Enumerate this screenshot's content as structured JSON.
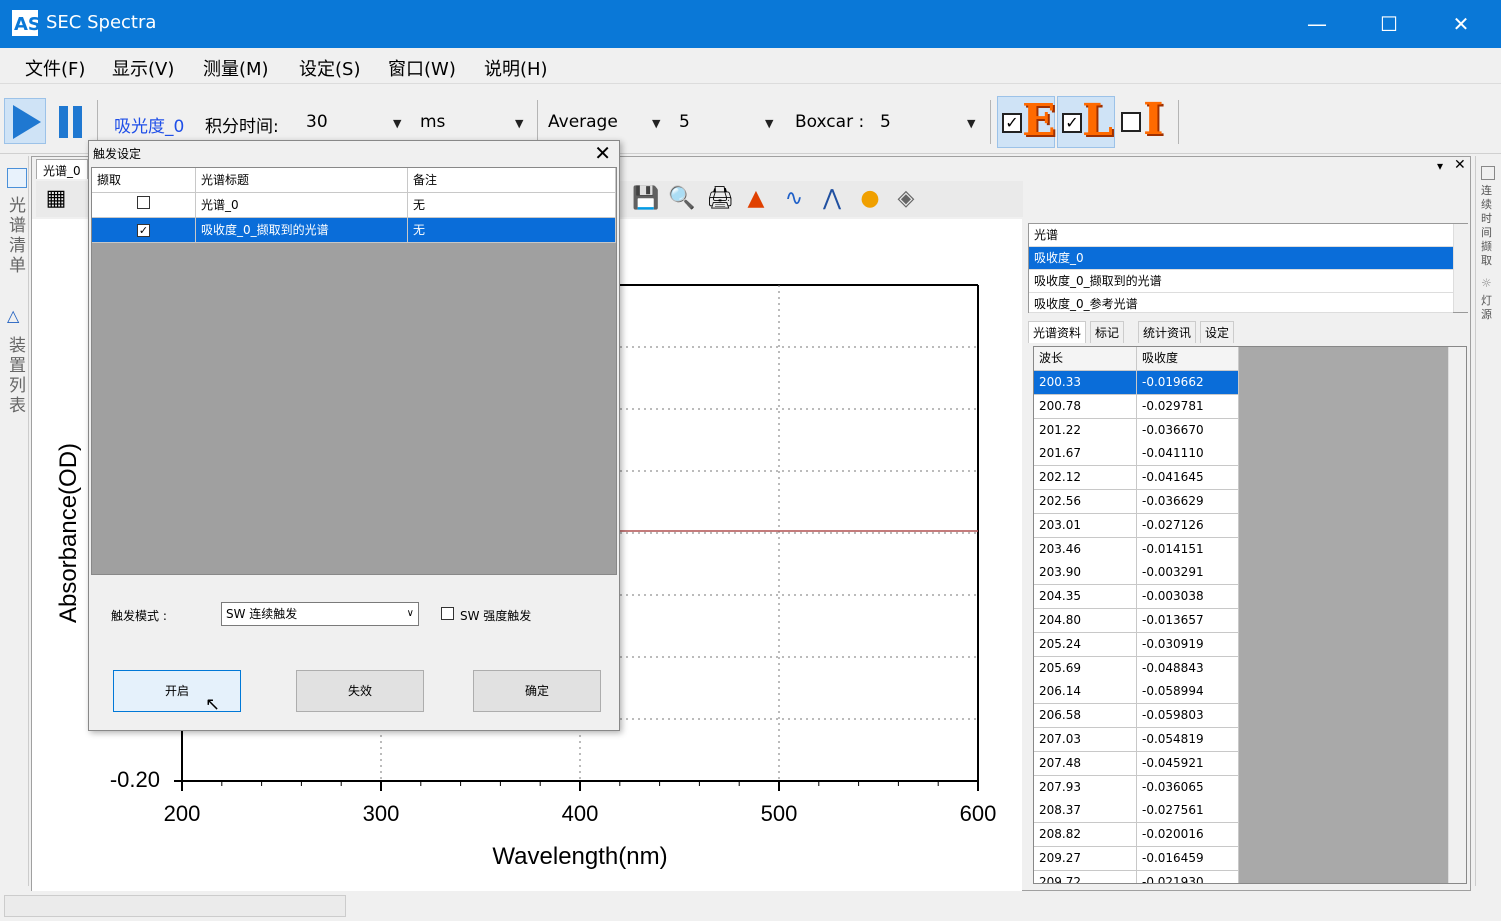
{
  "window": {
    "title": "SEC Spectra",
    "icon_label": "AS"
  },
  "menu": [
    "文件(F)",
    "显示(V)",
    "测量(M)",
    "设定(S)",
    "窗口(W)",
    "说明(H)"
  ],
  "toolbar": {
    "mode_label": "吸光度_0",
    "integration_label": "积分时间:",
    "integration_value": "30",
    "integration_unit": "ms",
    "average_label": "Average",
    "average_value": "5",
    "boxcar_label": "Boxcar :",
    "boxcar_value": "5",
    "eli": [
      {
        "letter": "E",
        "checked": true
      },
      {
        "letter": "L",
        "checked": true
      },
      {
        "letter": "I",
        "checked": false
      }
    ]
  },
  "left_panel": {
    "spectra_list_label": "光谱清单",
    "device_list_label": "装置列表"
  },
  "right_panel": {
    "label_top": "连续时间撷取",
    "label_bottom": "灯源"
  },
  "doc": {
    "tab_label": "光谱_0"
  },
  "chart_data": {
    "type": "line",
    "xlabel": "Wavelength(nm)",
    "ylabel": "Absorbance(OD)",
    "xlim": [
      200,
      600
    ],
    "x_ticks": [
      "200",
      "300",
      "400",
      "500",
      "600"
    ],
    "y_tick_visible": "-0.20",
    "series": [
      {
        "x": [
          420,
          450,
          480,
          500,
          520,
          550,
          580,
          600
        ],
        "values": [
          0.0,
          0.0,
          0.0,
          0.0,
          0.0,
          0.0,
          0.0,
          0.0
        ]
      }
    ],
    "grid": true
  },
  "spectra_panel": {
    "header": "光谱",
    "items": [
      "吸收度_0",
      "吸收度_0_撷取到的光谱",
      "吸收度_0_参考光谱"
    ],
    "selected_index": 0
  },
  "tabs": [
    "光谱资料",
    "标记",
    "统计资讯",
    "设定"
  ],
  "data_table": {
    "columns": [
      "波长",
      "吸收度"
    ],
    "rows": [
      [
        "200.33",
        "-0.019662"
      ],
      [
        "200.78",
        "-0.029781"
      ],
      [
        "201.22",
        "-0.036670"
      ],
      [
        "201.67",
        "-0.041110"
      ],
      [
        "202.12",
        "-0.041645"
      ],
      [
        "202.56",
        "-0.036629"
      ],
      [
        "203.01",
        "-0.027126"
      ],
      [
        "203.46",
        "-0.014151"
      ],
      [
        "203.90",
        "-0.003291"
      ],
      [
        "204.35",
        "-0.003038"
      ],
      [
        "204.80",
        "-0.013657"
      ],
      [
        "205.24",
        "-0.030919"
      ],
      [
        "205.69",
        "-0.048843"
      ],
      [
        "206.14",
        "-0.058994"
      ],
      [
        "206.58",
        "-0.059803"
      ],
      [
        "207.03",
        "-0.054819"
      ],
      [
        "207.48",
        "-0.045921"
      ],
      [
        "207.93",
        "-0.036065"
      ],
      [
        "208.37",
        "-0.027561"
      ],
      [
        "208.82",
        "-0.020016"
      ],
      [
        "209.27",
        "-0.016459"
      ],
      [
        "209.72",
        "-0.021930"
      ]
    ],
    "selected_index": 0
  },
  "dialog": {
    "title": "触发设定",
    "close": "✕",
    "columns": [
      "撷取",
      "光谱标题",
      "备注"
    ],
    "rows": [
      {
        "checked": false,
        "title": "光谱_0",
        "note": "无"
      },
      {
        "checked": true,
        "title": "吸收度_0_撷取到的光谱",
        "note": "无"
      }
    ],
    "selected_row": 1,
    "trigger_mode_label": "触发模式 :",
    "trigger_mode_value": "SW 连续触发",
    "intensity_trigger_label": "SW 强度触发",
    "intensity_trigger_checked": false,
    "buttons": {
      "enable": "开启",
      "disable": "失效",
      "ok": "确定"
    }
  }
}
